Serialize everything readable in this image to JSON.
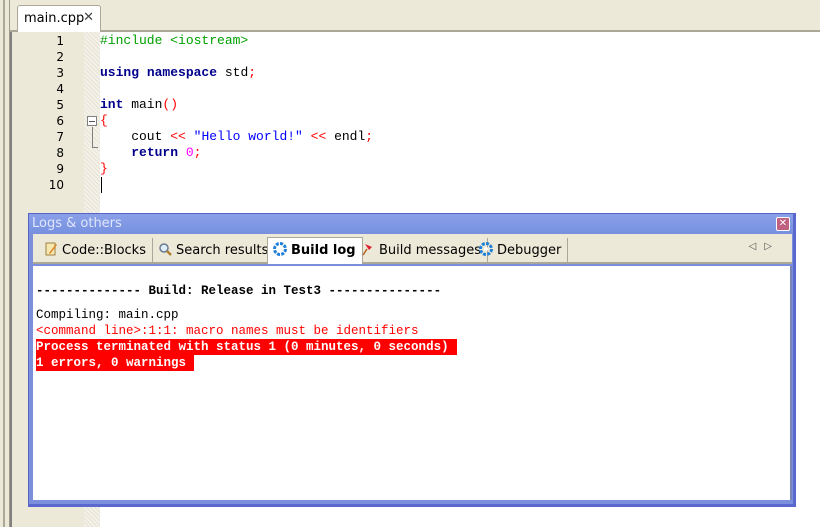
{
  "editor": {
    "tab_label": "main.cpp",
    "lines": [
      {
        "n": "1",
        "segments": [
          {
            "t": "#include <iostream>",
            "c": "pp"
          }
        ]
      },
      {
        "n": "2",
        "segments": []
      },
      {
        "n": "3",
        "segments": [
          {
            "t": "using",
            "c": "kw"
          },
          {
            "t": " "
          },
          {
            "t": "namespace",
            "c": "kw"
          },
          {
            "t": " std"
          },
          {
            "t": ";",
            "c": "op"
          }
        ]
      },
      {
        "n": "4",
        "segments": []
      },
      {
        "n": "5",
        "segments": [
          {
            "t": "int",
            "c": "kw"
          },
          {
            "t": " main"
          },
          {
            "t": "()",
            "c": "op"
          }
        ]
      },
      {
        "n": "6",
        "segments": [
          {
            "t": "{",
            "c": "op"
          }
        ]
      },
      {
        "n": "7",
        "segments": [
          {
            "t": "    cout "
          },
          {
            "t": "<<",
            "c": "op"
          },
          {
            "t": " "
          },
          {
            "t": "\"Hello world!\"",
            "c": "str"
          },
          {
            "t": " "
          },
          {
            "t": "<<",
            "c": "op"
          },
          {
            "t": " endl"
          },
          {
            "t": ";",
            "c": "op"
          }
        ]
      },
      {
        "n": "8",
        "segments": [
          {
            "t": "    "
          },
          {
            "t": "return",
            "c": "kw"
          },
          {
            "t": " "
          },
          {
            "t": "0",
            "c": "num"
          },
          {
            "t": ";",
            "c": "op"
          }
        ]
      },
      {
        "n": "9",
        "segments": [
          {
            "t": "}",
            "c": "op"
          }
        ]
      },
      {
        "n": "10",
        "segments": []
      }
    ]
  },
  "panel": {
    "title": "Logs & others",
    "tabs": [
      {
        "label": "Code::Blocks",
        "icon": "notepad-pencil-icon"
      },
      {
        "label": "Search results",
        "icon": "magnifier-icon"
      },
      {
        "label": "Build log",
        "icon": "gear-icon",
        "active": true
      },
      {
        "label": "Build messages",
        "icon": "pushpin-icon"
      },
      {
        "label": "Debugger",
        "icon": "gear-icon"
      }
    ],
    "log": {
      "header": "-------------- Build: Release in Test3 ---------------",
      "compiling": "Compiling: main.cpp",
      "error_line": "<command line>:1:1: macro names must be identifiers",
      "status": "Process terminated with status 1 (0 minutes, 0 seconds)",
      "summary": "1 errors, 0 warnings"
    }
  },
  "colors": {
    "error_bg": "#ff0000",
    "panel_border": "#7b8fdc"
  }
}
